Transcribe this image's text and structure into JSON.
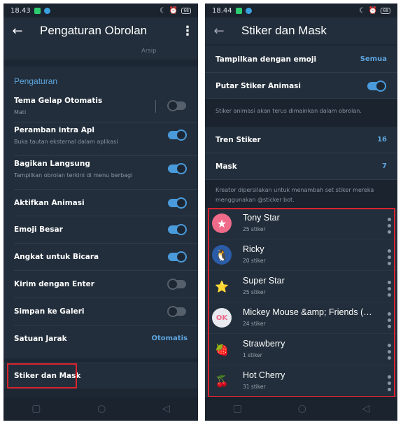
{
  "left": {
    "status": {
      "time": "18.43",
      "battery": "68"
    },
    "header": {
      "title": "Pengaturan Obrolan"
    },
    "tab": "Arsip",
    "section_title": "Pengaturan",
    "rows": [
      {
        "title": "Tema Gelap Otomatis",
        "subtitle": "Mati",
        "toggle": false
      },
      {
        "title": "Peramban intra Apl",
        "subtitle": "Buka tautan eksternal dalam aplikasi",
        "toggle": true
      },
      {
        "title": "Bagikan Langsung",
        "subtitle": "Tampilkan obrolan terkini di menu berbagi",
        "toggle": true
      },
      {
        "title": "Aktifkan Animasi",
        "toggle": true
      },
      {
        "title": "Emoji Besar",
        "toggle": true
      },
      {
        "title": "Angkat untuk Bicara",
        "toggle": true
      },
      {
        "title": "Kirim dengan Enter",
        "toggle": false
      },
      {
        "title": "Simpan ke Galeri",
        "toggle": false
      },
      {
        "title": "Satuan Jarak",
        "value": "Otomatis"
      }
    ],
    "stickers_item": "Stiker dan Mask"
  },
  "right": {
    "status": {
      "time": "18.44",
      "battery": "68"
    },
    "header": {
      "title": "Stiker dan Mask"
    },
    "show_emoji": {
      "title": "Tampilkan dengan emoji",
      "value": "Semua"
    },
    "animated": {
      "title": "Putar Stiker Animasi",
      "toggle": true
    },
    "animated_info": "Stiker animasi akan terus dimainkan dalam obrolan.",
    "trending": {
      "title": "Tren Stiker",
      "value": "16"
    },
    "masks": {
      "title": "Mask",
      "value": "7"
    },
    "creator_info": "Kreator dipersilakan untuk menambah set stiker mereka menggunakan @sticker bot.",
    "sticker_sets": [
      {
        "name": "Tony Star",
        "count": "25 stiker",
        "icon": "pink-star-sticker"
      },
      {
        "name": "Ricky",
        "count": "20 stiker",
        "icon": "penguin-sticker"
      },
      {
        "name": "Super Star",
        "count": "25 stiker",
        "icon": "yellow-star-sticker"
      },
      {
        "name": "Mickey Mouse &amp; Friends (…",
        "count": "24 stiker",
        "icon": "ok-sticker"
      },
      {
        "name": "Strawberry",
        "count": "1 stiker",
        "icon": "strawberry-sticker"
      },
      {
        "name": "Hot Cherry",
        "count": "31 stiker",
        "icon": "cherry-sticker"
      }
    ]
  },
  "colors": {
    "accent": "#4a9bdc",
    "highlight": "#d8242f",
    "background": "#1d2733"
  }
}
